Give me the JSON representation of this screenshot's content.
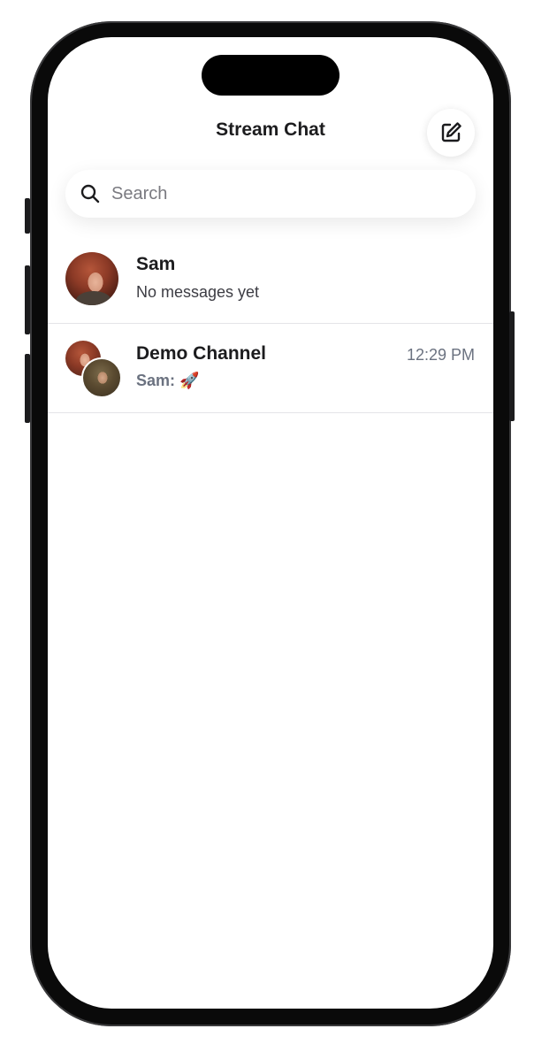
{
  "app": {
    "title": "Stream Chat"
  },
  "toolbar": {
    "compose_icon": "compose-icon"
  },
  "search": {
    "placeholder": "Search",
    "value": "",
    "icon": "magnifying-glass-icon"
  },
  "channels": [
    {
      "name": "Sam",
      "preview": "No messages yet",
      "time": "",
      "avatar": "single-user-avatar"
    },
    {
      "name": "Demo Channel",
      "preview_sender": "Sam:",
      "preview": "🚀",
      "time": "12:29 PM",
      "avatar": "group-avatar"
    }
  ],
  "colors": {
    "title": "#1c1c1e",
    "secondary_text": "#6b7280",
    "divider": "#e4e4e8",
    "background": "#ffffff"
  }
}
